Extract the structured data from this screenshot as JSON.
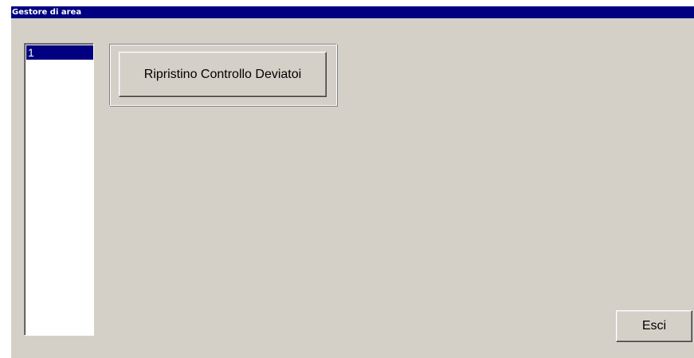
{
  "window": {
    "title": "Gestore di area"
  },
  "area_list": {
    "items": [
      "1"
    ],
    "selected_index": 0
  },
  "actions": {
    "restore_label": "Ripristino Controllo Deviatoi",
    "exit_label": "Esci"
  },
  "colors": {
    "title_bar": "#000080",
    "window_background": "#d4d0c8",
    "selection": "#000080",
    "list_background": "#ffffff"
  }
}
